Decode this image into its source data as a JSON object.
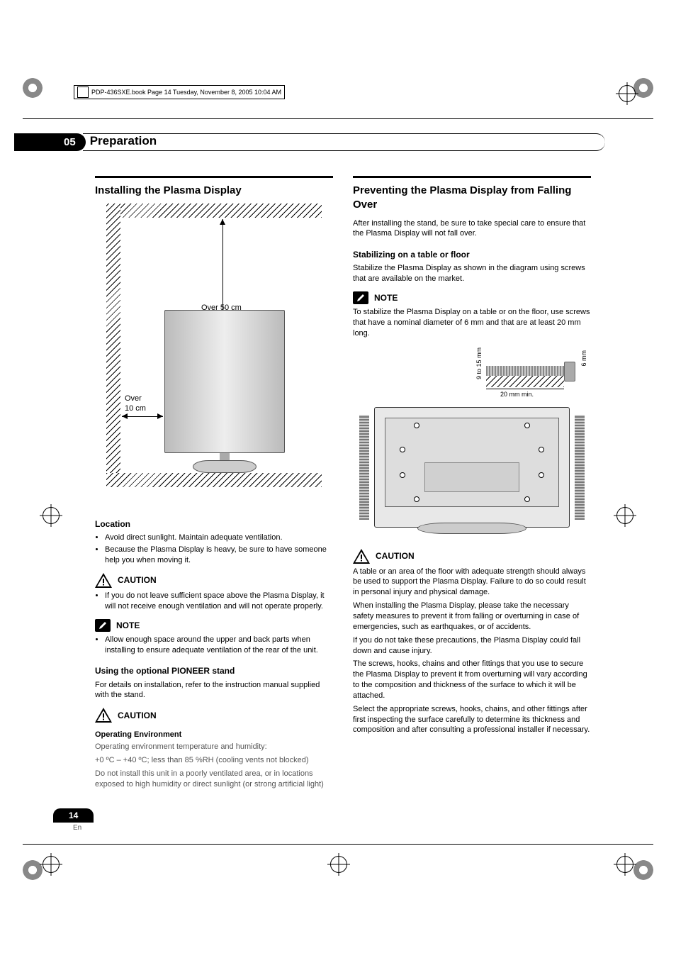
{
  "header": {
    "book_line": "PDP-436SXE.book  Page 14  Tuesday, November 8, 2005  10:04 AM"
  },
  "section": {
    "number": "05",
    "title": "Preparation"
  },
  "left": {
    "h1": "Installing the Plasma Display",
    "fig": {
      "over50": "Over 50 cm",
      "over10a": "Over",
      "over10b": "10 cm"
    },
    "location": {
      "title": "Location",
      "items": [
        "Avoid direct sunlight. Maintain adequate ventilation.",
        "Because the Plasma Display is heavy, be sure to have someone help you when moving it."
      ]
    },
    "caution1": {
      "label": "CAUTION",
      "item": "If you do not leave sufficient space above the Plasma Display, it will not receive enough ventilation and will not operate properly."
    },
    "note1": {
      "label": "NOTE",
      "item": "Allow enough space around the upper and back parts when installing to ensure adequate ventilation of the rear of the unit."
    },
    "pioneer": {
      "title": "Using the optional PIONEER stand",
      "text": "For details on installation, refer to the instruction manual supplied with the stand."
    },
    "caution2": {
      "label": "CAUTION"
    },
    "env": {
      "title": "Operating Environment",
      "l1": "Operating environment temperature and humidity:",
      "l2": "+0 ºC – +40 ºC; less than 85 %RH (cooling vents not blocked)",
      "l3": "Do not install this unit in a poorly ventilated area, or in locations exposed to high humidity or direct sunlight (or strong artificial light)"
    }
  },
  "right": {
    "h1": "Preventing the Plasma Display from Falling Over",
    "intro": "After installing the stand, be sure to take special care to ensure that the Plasma Display will not fall over.",
    "stab": {
      "title": "Stabilizing on a table or floor",
      "text": "Stabilize the Plasma Display as shown in the diagram using screws that are available on the market."
    },
    "note": {
      "label": "NOTE",
      "text": "To stabilize the Plasma Display on a table or on the floor, use screws that have a nominal diameter of 6 mm and that are at least 20 mm long."
    },
    "fig": {
      "d6": "6 mm",
      "len": "9 to 15 mm",
      "min": "20 mm min."
    },
    "caution": {
      "label": "CAUTION",
      "p1": "A table or an area of the floor with adequate strength should always be used to support the Plasma Display. Failure to do so could result in personal injury and physical damage.",
      "p2": "When installing the Plasma Display, please take the necessary safety measures to prevent it from falling or overturning in case of emergencies, such as earthquakes, or of accidents.",
      "p3": "If you do not take these precautions, the Plasma Display could fall down and cause injury.",
      "p4": "The screws, hooks, chains and other fittings that you use to secure the Plasma Display to prevent it from overturning will vary according to the composition and thickness of the surface to which it will be attached.",
      "p5": "Select the appropriate screws, hooks, chains, and other fittings after first inspecting the surface carefully to determine its thickness and composition and after consulting a professional installer if necessary."
    }
  },
  "footer": {
    "page": "14",
    "lang": "En"
  }
}
